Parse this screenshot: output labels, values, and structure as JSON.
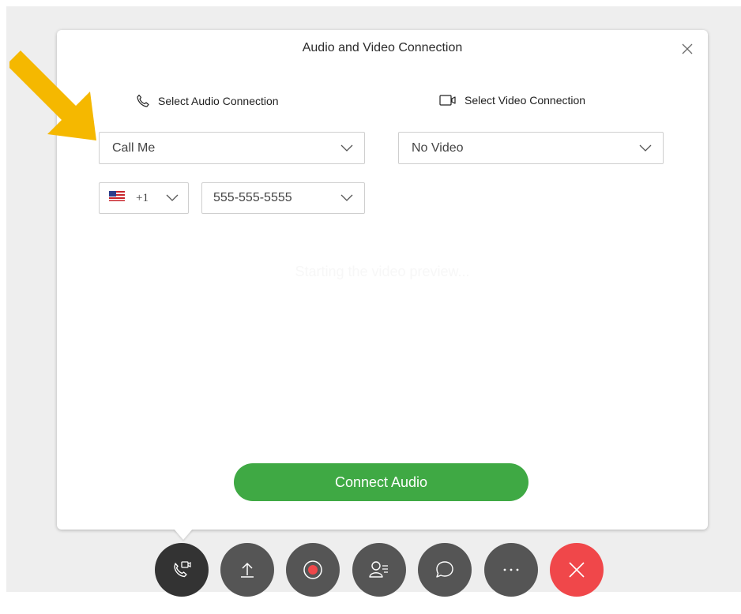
{
  "dialog": {
    "title": "Audio and Video Connection",
    "close_icon": "close-icon",
    "ghost_text": "Starting the video preview..."
  },
  "audio": {
    "label": "Select Audio Connection",
    "icon": "phone-icon",
    "selected": "Call Me",
    "country_flag": "us-flag-icon",
    "country_code": "+1",
    "phone_number": "555-555-5555"
  },
  "video": {
    "label": "Select Video Connection",
    "icon": "video-camera-icon",
    "selected": "No Video"
  },
  "connect_button": {
    "label": "Connect Audio",
    "color": "#3fa944"
  },
  "annotation": {
    "icon": "arrow-pointer-icon",
    "color": "#f5b800"
  },
  "toolbar": {
    "buttons": [
      {
        "name": "audio-video-button",
        "icon": "phone-video-icon",
        "color": "#333333"
      },
      {
        "name": "share-button",
        "icon": "share-upload-icon",
        "color": "#555555"
      },
      {
        "name": "record-button",
        "icon": "record-icon",
        "color": "#555555"
      },
      {
        "name": "participants-button",
        "icon": "participants-icon",
        "color": "#555555"
      },
      {
        "name": "chat-button",
        "icon": "chat-bubble-icon",
        "color": "#555555"
      },
      {
        "name": "more-button",
        "icon": "more-options-icon",
        "color": "#555555"
      },
      {
        "name": "leave-button",
        "icon": "close-icon",
        "color": "#f0474a"
      }
    ]
  }
}
